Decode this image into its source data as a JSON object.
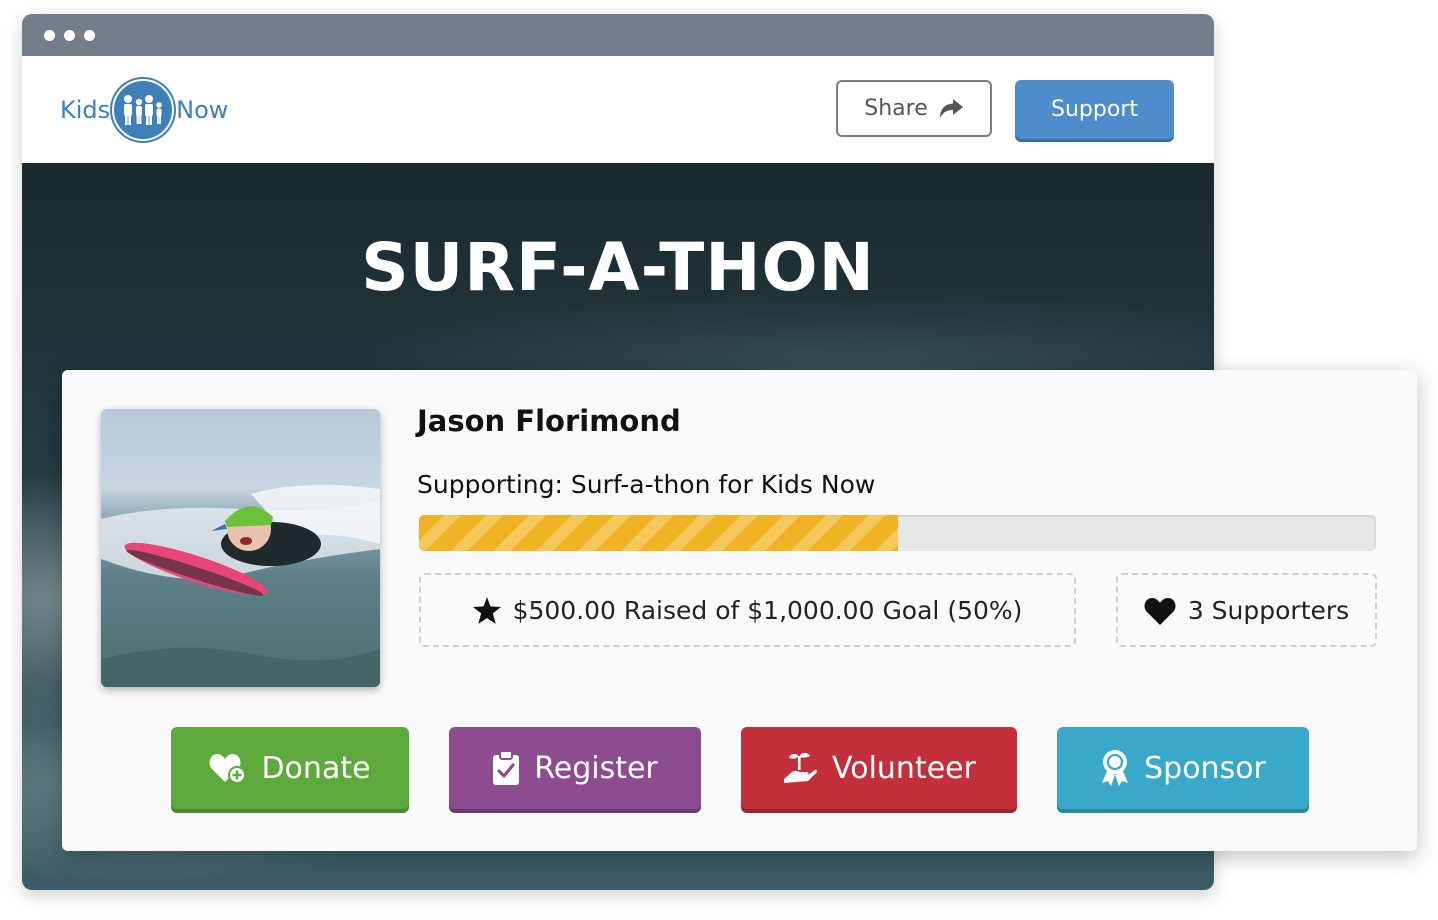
{
  "header": {
    "logo_left": "Kids",
    "logo_right": "Now",
    "share_label": "Share",
    "support_label": "Support"
  },
  "hero": {
    "title": "SURF-A-THON"
  },
  "fundraiser": {
    "name": "Jason Florimond",
    "supporting": "Supporting: Surf-a-thon for Kids Now",
    "progress_fraction": 0.5,
    "raised_text": "$500.00 Raised of $1,000.00 Goal (50%)",
    "supporters_text": "3 Supporters"
  },
  "actions": {
    "donate": "Donate",
    "register": "Register",
    "volunteer": "Volunteer",
    "sponsor": "Sponsor"
  },
  "colors": {
    "brand_blue": "#4f8ccb",
    "progress": "#f0b323",
    "donate": "#5ea93c",
    "register": "#8c4c8f",
    "volunteer": "#c42f3c",
    "sponsor": "#3aa8c8"
  },
  "icons": {
    "share": "share-arrow-icon",
    "raised": "star-icon",
    "supporters": "heart-icon",
    "donate": "heart-plus-icon",
    "register": "clipboard-check-icon",
    "volunteer": "hand-seedling-icon",
    "sponsor": "award-ribbon-icon"
  }
}
